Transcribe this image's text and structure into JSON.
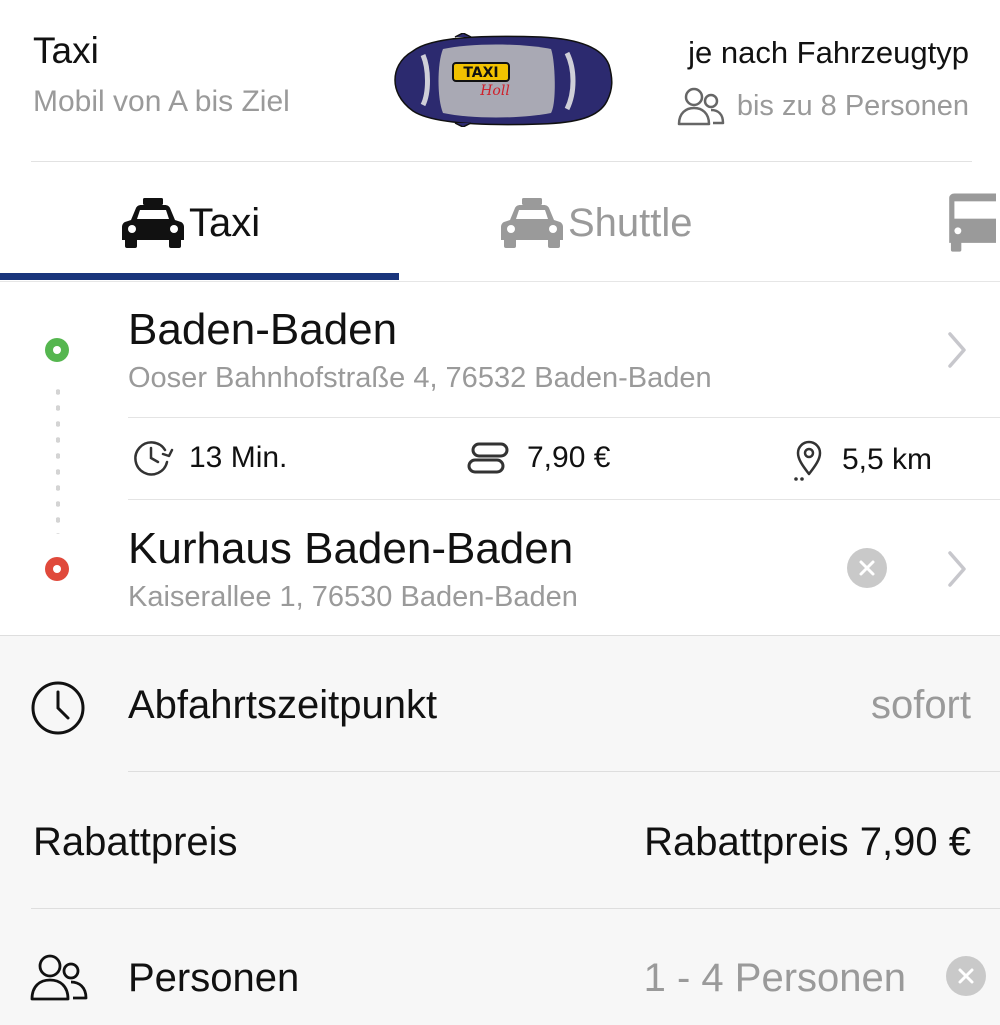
{
  "header": {
    "title": "Taxi",
    "subtitle": "Mobil von A bis Ziel",
    "vehicle_info": "je nach Fahrzeugtyp",
    "capacity": "bis zu 8 Personen",
    "car_logo_text": "TAXI"
  },
  "tabs": [
    {
      "label": "Taxi",
      "selected": true
    },
    {
      "label": "Shuttle",
      "selected": false
    }
  ],
  "route": {
    "start": {
      "name": "Baden-Baden",
      "address": "Ooser Bahnhofstraße 4, 76532 Baden-Baden"
    },
    "end": {
      "name": "Kurhaus Baden-Baden",
      "address": "Kaiserallee 1, 76530 Baden-Baden"
    },
    "duration": "13 Min.",
    "price": "7,90 €",
    "distance": "5,5 km"
  },
  "settings": {
    "departure_label": "Abfahrtszeitpunkt",
    "departure_value": "sofort",
    "discount_label": "Rabattpreis",
    "discount_value": "Rabattpreis 7,90 €",
    "persons_label": "Personen",
    "persons_value": "1 - 4 Personen"
  },
  "colors": {
    "accent": "#1a357c",
    "start_dot": "#55b64f",
    "end_dot": "#e0493b",
    "muted_text": "#9a9a9a"
  }
}
